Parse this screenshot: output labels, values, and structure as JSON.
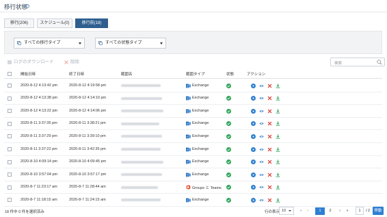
{
  "header": {
    "title": "移行状態",
    "info_icon": "info-icon"
  },
  "tabs": [
    {
      "label": "移行(206)",
      "active": false
    },
    {
      "label": "スケジュール(0)",
      "active": false
    },
    {
      "label": "移行前(18)",
      "active": true
    }
  ],
  "filters": {
    "type_select": {
      "value": "すべての移行タイプ",
      "icon": "layers-icon"
    },
    "status_select": {
      "value": "すべての状態タイプ",
      "icon": "layers-icon"
    }
  },
  "toolbar": {
    "download_label": "ログのダウンロード",
    "delete_label": "削除",
    "search_placeholder": "検索"
  },
  "table": {
    "columns": {
      "start": "開始日時",
      "end": "終了日時",
      "source": "範囲名",
      "type": "範囲タイプ",
      "status": "状態",
      "actions": "アクション"
    },
    "rows": [
      {
        "start": "2020-8-12 4:13:42 pm",
        "end": "2020-8-12 4:19:58 pm",
        "type": "Exchange",
        "type_kind": "exchange",
        "status": "complete"
      },
      {
        "start": "2020-8-12 4:13:38 pm",
        "end": "2020-8-12 4:14:10 pm",
        "type": "Exchange",
        "type_kind": "exchange",
        "status": "complete"
      },
      {
        "start": "2020-8-12 4:13:22 pm",
        "end": "2020-8-12 4:14:06 pm",
        "type": "Exchange",
        "type_kind": "exchange",
        "status": "complete"
      },
      {
        "start": "2020-8-11 3:37:35 pm",
        "end": "2020-8-11 3:38:21 pm",
        "type": "Exchange",
        "type_kind": "exchange",
        "status": "complete"
      },
      {
        "start": "2020-8-11 3:37:29 pm",
        "end": "2020-8-11 3:39:10 pm",
        "type": "Exchange",
        "type_kind": "exchange",
        "status": "complete"
      },
      {
        "start": "2020-8-11 3:37:22 pm",
        "end": "2020-8-11 3:42:35 pm",
        "type": "Exchange",
        "type_kind": "exchange",
        "status": "complete"
      },
      {
        "start": "2020-8-10 4:09:14 pm",
        "end": "2020-8-10 4:09:45 pm",
        "type": "Exchange",
        "type_kind": "exchange",
        "status": "complete"
      },
      {
        "start": "2020-8-10 3:57:04 pm",
        "end": "2020-8-10 3:57:17 pm",
        "type": "Exchange",
        "type_kind": "exchange",
        "status": "complete"
      },
      {
        "start": "2020-8-7 11:23:17 am",
        "end": "2020-8-7 11:28:44 am",
        "type": "Groups と Teams",
        "type_kind": "office",
        "status": "complete"
      },
      {
        "start": "2020-8-7 11:18:15 am",
        "end": "2020-8-7 11:24:15 am",
        "type": "Exchange",
        "type_kind": "exchange",
        "status": "complete"
      }
    ],
    "row_actions": [
      "play-icon",
      "eye-icon",
      "cross-icon",
      "download-icon"
    ]
  },
  "footer": {
    "selection": "18 件中 0 件を選択済み",
    "rows_label": "行の表示:",
    "rows_value": "10",
    "pages": [
      "1",
      "2"
    ],
    "current_page": "1",
    "page_input": "1",
    "page_total": "/ 2",
    "go_label": "移動"
  },
  "colors": {
    "accent": "#2f5f8f",
    "primary_blue": "#2f7fd1",
    "status_green": "#2fa55a",
    "delete_red": "#d9453c",
    "exchange_blue": "#1c63b8",
    "office_red": "#e0502a"
  }
}
